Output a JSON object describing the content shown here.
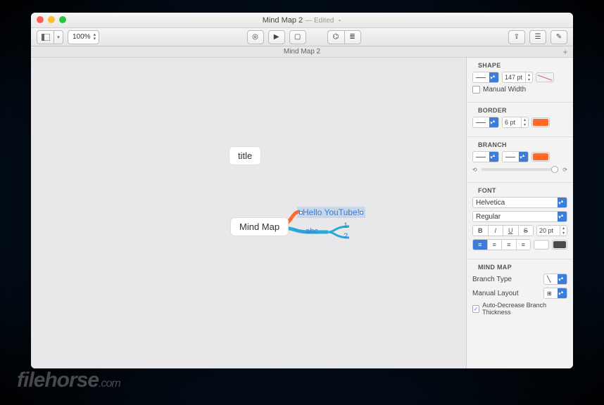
{
  "window": {
    "title": "Mind Map 2",
    "edited": "— Edited"
  },
  "toolbar": {
    "zoom": "100%"
  },
  "tab": {
    "name": "Mind Map 2"
  },
  "canvas": {
    "title_node": "title",
    "main_node": "Mind Map",
    "selected_text": "Hello YouTube!",
    "abc": "abc",
    "n1": "1",
    "n2": "2"
  },
  "shape": {
    "header": "SHAPE",
    "width_value": "147 pt",
    "manual_width": "Manual Width"
  },
  "border": {
    "header": "BORDER",
    "width_value": "6 pt",
    "color": "#ff6a2b"
  },
  "branch": {
    "header": "BRANCH",
    "color": "#ff6a2b"
  },
  "font": {
    "header": "FONT",
    "family": "Helvetica",
    "style": "Regular",
    "b": "B",
    "i": "I",
    "u": "U",
    "s": "S",
    "size": "20 pt",
    "text_color": "#ffffff",
    "bg_color": "#4a4a4a"
  },
  "mindmap": {
    "header": "MIND MAP",
    "branch_type": "Branch Type",
    "manual_layout": "Manual Layout",
    "auto_decrease": "Auto-Decrease Branch Thickness"
  },
  "watermark": {
    "text": "filehorse",
    "suffix": ".com"
  }
}
